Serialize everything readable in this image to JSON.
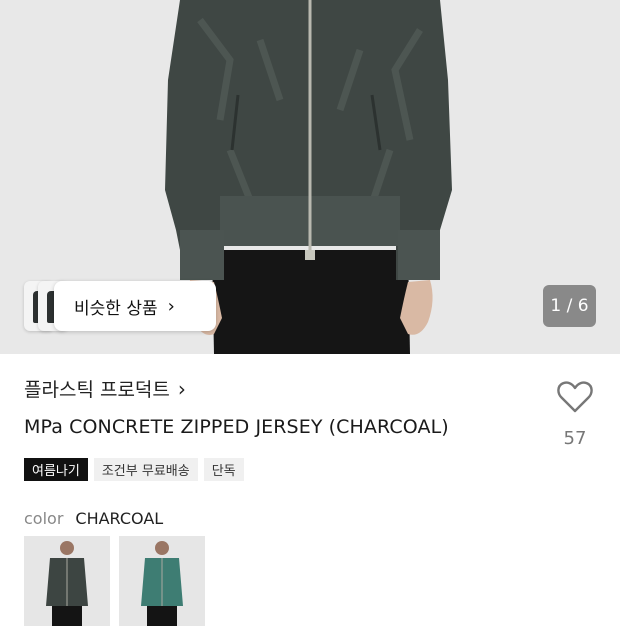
{
  "similar": {
    "label": "비슷한 상품"
  },
  "gallery": {
    "counter": "1 / 6",
    "current": 1,
    "total": 6
  },
  "product": {
    "brand": "플라스틱 프로덕트",
    "title": "MPa CONCRETE ZIPPED JERSEY (CHARCOAL)",
    "likes": "57",
    "tags": [
      "여름나기",
      "조건부 무료배송",
      "단독"
    ]
  },
  "color": {
    "label": "color",
    "selected": "CHARCOAL",
    "options": [
      "charcoal",
      "green"
    ]
  },
  "colors": {
    "jacket": "#3d4542",
    "jacket_green": "#3e7d73",
    "background": "#e9e9e9",
    "tag_dark": "#111111"
  }
}
